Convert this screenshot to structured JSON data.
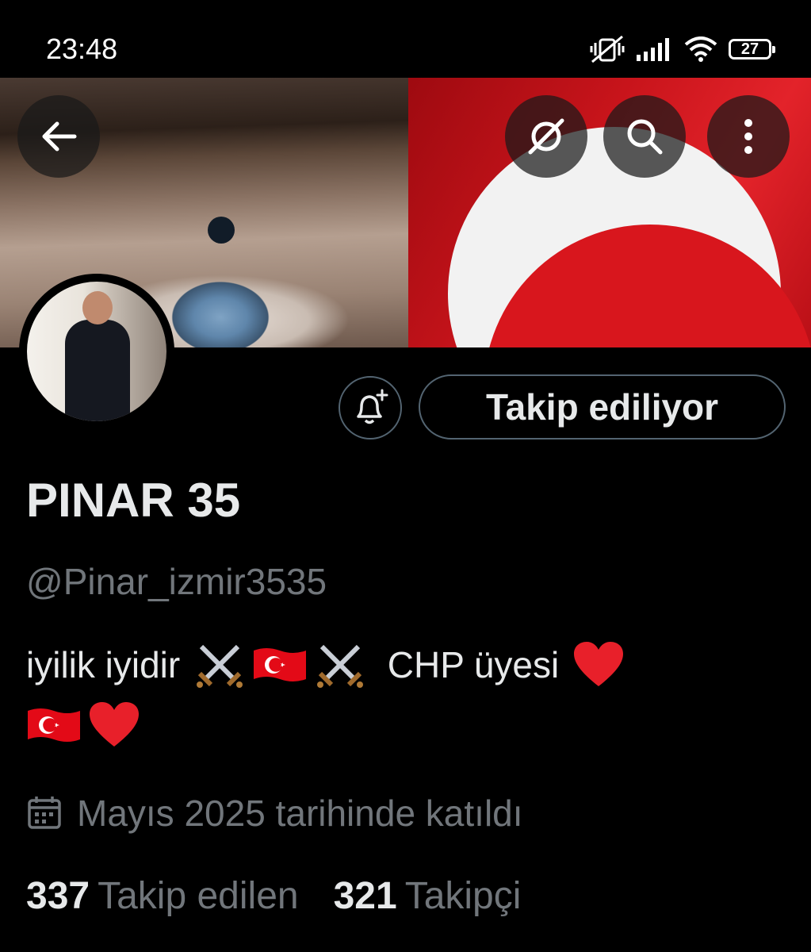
{
  "status_bar": {
    "time": "23:48",
    "battery": "27",
    "icons": [
      "mute-vibrate-icon",
      "signal-icon",
      "wifi-icon",
      "battery-icon"
    ]
  },
  "header": {
    "back_icon": "arrow-left-icon",
    "actions": [
      "grok-icon",
      "search-icon",
      "more-vertical-icon"
    ]
  },
  "profile": {
    "display_name": "PINAR 35",
    "handle": "@Pinar_izmir3535",
    "bio_line1_text1": "iyilik iyidir ",
    "bio_line1_text2": " CHP üyesi ",
    "joined": "Mayıs 2025 tarihinde katıldı",
    "follow_button": "Takip ediliyor",
    "notify_icon": "bell-plus-icon"
  },
  "stats": {
    "following_count": "337",
    "following_label": "Takip edilen",
    "followers_count": "321",
    "followers_label": "Takipçi"
  },
  "colors": {
    "background": "#000000",
    "text_primary": "#e7e9ea",
    "text_secondary": "#71767b",
    "border": "#536471"
  }
}
